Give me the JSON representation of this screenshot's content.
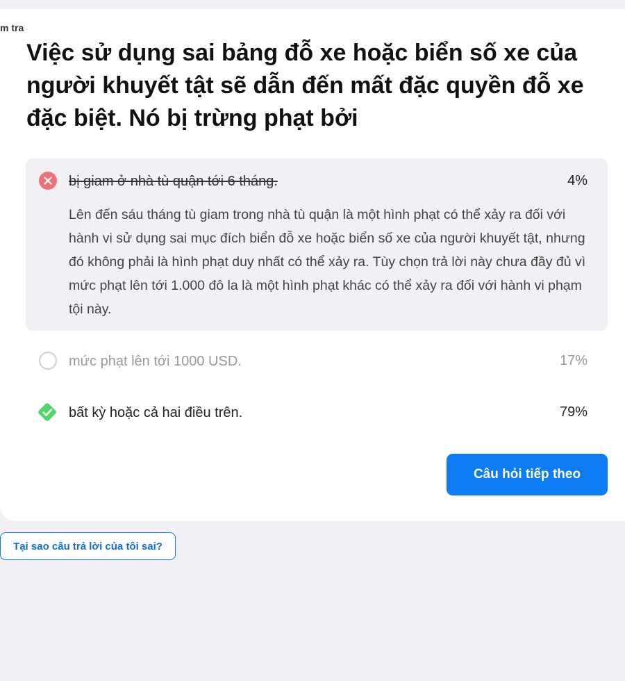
{
  "header": {
    "corner_label": "m tra"
  },
  "question": {
    "text": "Việc sử dụng sai bảng đỗ xe hoặc biển số xe của người khuyết tật sẽ dẫn đến mất đặc quyền đỗ xe đặc biệt. Nó bị trừng phạt bởi"
  },
  "options": [
    {
      "text": "bị giam ở nhà tù quận tới 6 tháng.",
      "percent": "4%",
      "state": "selected-wrong",
      "icon": "x-circle-icon",
      "explanation": "Lên đến sáu tháng tù giam trong nhà tù quận là một hình phạt có thể xảy ra đối với hành vi sử dụng sai mục đích biển đỗ xe hoặc biển số xe của người khuyết tật, nhưng đó không phải là hình phạt duy nhất có thể xảy ra. Tùy chọn trả lời này chưa đầy đủ vì mức phạt lên tới 1.000 đô la là một hình phạt khác có thể xảy ra đối với hành vi phạm tội này."
    },
    {
      "text": "mức phạt lên tới 1000 USD.",
      "percent": "17%",
      "state": "unselected",
      "icon": "empty-circle-icon"
    },
    {
      "text": "bất kỳ hoặc cả hai điều trên.",
      "percent": "79%",
      "state": "correct",
      "icon": "check-diamond-icon"
    }
  ],
  "actions": {
    "next_label": "Câu hỏi tiếp theo",
    "why_wrong_label": "Tại sao câu trả lời của tôi sai?"
  },
  "colors": {
    "wrong": "#f0707a",
    "correct": "#4fd86a",
    "primary": "#0d7bf2",
    "explanation_bg": "#f1f1f5",
    "page_bg": "#f0f0f5"
  }
}
